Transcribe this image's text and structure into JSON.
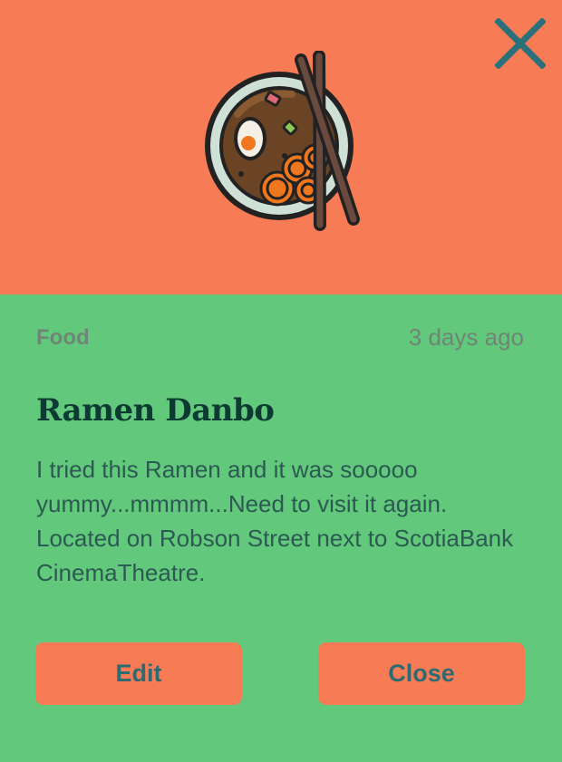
{
  "header": {
    "close_icon": "close-icon",
    "image_icon": "ramen-bowl-icon",
    "background_color": "#f77b55",
    "close_color": "#2c7179"
  },
  "post": {
    "category": "Food",
    "time_ago": "3 days ago",
    "title": "Ramen Danbo",
    "description": "I tried this Ramen and it was sooooo yummy...mmmm...Need to visit it again. Located on Robson Street next to ScotiaBank CinemaTheatre."
  },
  "actions": {
    "edit_label": "Edit",
    "close_label": "Close"
  },
  "colors": {
    "body_background": "#62c87b",
    "button_background": "#f77b55",
    "button_text": "#2d6a72",
    "title_text": "#0d3a33"
  }
}
